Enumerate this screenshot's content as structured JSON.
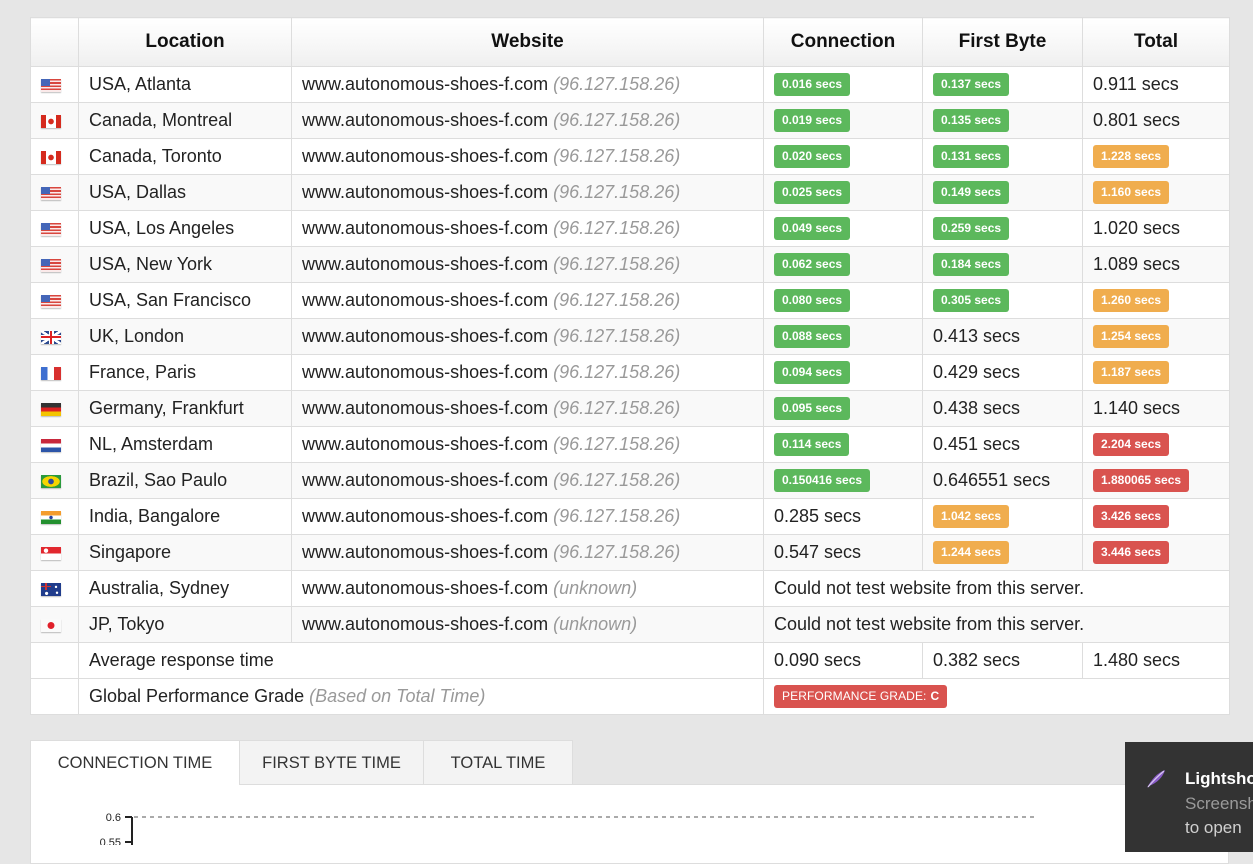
{
  "table": {
    "headers": {
      "flag": "",
      "location": "Location",
      "website": "Website",
      "connection": "Connection",
      "first_byte": "First Byte",
      "total": "Total"
    },
    "rows": [
      {
        "flag": "us",
        "location": "USA, Atlanta",
        "website": "www.autonomous-shoes-f.com",
        "ip": "(96.127.158.26)",
        "connection": {
          "value": "0.016 secs",
          "status": "good"
        },
        "first_byte": {
          "value": "0.137 secs",
          "status": "good"
        },
        "total": {
          "value": "0.911 secs",
          "status": "plain"
        }
      },
      {
        "flag": "ca",
        "location": "Canada, Montreal",
        "website": "www.autonomous-shoes-f.com",
        "ip": "(96.127.158.26)",
        "connection": {
          "value": "0.019 secs",
          "status": "good"
        },
        "first_byte": {
          "value": "0.135 secs",
          "status": "good"
        },
        "total": {
          "value": "0.801 secs",
          "status": "plain"
        }
      },
      {
        "flag": "ca",
        "location": "Canada, Toronto",
        "website": "www.autonomous-shoes-f.com",
        "ip": "(96.127.158.26)",
        "connection": {
          "value": "0.020 secs",
          "status": "good"
        },
        "first_byte": {
          "value": "0.131 secs",
          "status": "good"
        },
        "total": {
          "value": "1.228 secs",
          "status": "warn"
        }
      },
      {
        "flag": "us",
        "location": "USA, Dallas",
        "website": "www.autonomous-shoes-f.com",
        "ip": "(96.127.158.26)",
        "connection": {
          "value": "0.025 secs",
          "status": "good"
        },
        "first_byte": {
          "value": "0.149 secs",
          "status": "good"
        },
        "total": {
          "value": "1.160 secs",
          "status": "warn"
        }
      },
      {
        "flag": "us",
        "location": "USA, Los Angeles",
        "website": "www.autonomous-shoes-f.com",
        "ip": "(96.127.158.26)",
        "connection": {
          "value": "0.049 secs",
          "status": "good"
        },
        "first_byte": {
          "value": "0.259 secs",
          "status": "good"
        },
        "total": {
          "value": "1.020 secs",
          "status": "plain"
        }
      },
      {
        "flag": "us",
        "location": "USA, New York",
        "website": "www.autonomous-shoes-f.com",
        "ip": "(96.127.158.26)",
        "connection": {
          "value": "0.062 secs",
          "status": "good"
        },
        "first_byte": {
          "value": "0.184 secs",
          "status": "good"
        },
        "total": {
          "value": "1.089 secs",
          "status": "plain"
        }
      },
      {
        "flag": "us",
        "location": "USA, San Francisco",
        "website": "www.autonomous-shoes-f.com",
        "ip": "(96.127.158.26)",
        "connection": {
          "value": "0.080 secs",
          "status": "good"
        },
        "first_byte": {
          "value": "0.305 secs",
          "status": "good"
        },
        "total": {
          "value": "1.260 secs",
          "status": "warn"
        }
      },
      {
        "flag": "gb",
        "location": "UK, London",
        "website": "www.autonomous-shoes-f.com",
        "ip": "(96.127.158.26)",
        "connection": {
          "value": "0.088 secs",
          "status": "good"
        },
        "first_byte": {
          "value": "0.413 secs",
          "status": "plain"
        },
        "total": {
          "value": "1.254 secs",
          "status": "warn"
        }
      },
      {
        "flag": "fr",
        "location": "France, Paris",
        "website": "www.autonomous-shoes-f.com",
        "ip": "(96.127.158.26)",
        "connection": {
          "value": "0.094 secs",
          "status": "good"
        },
        "first_byte": {
          "value": "0.429 secs",
          "status": "plain"
        },
        "total": {
          "value": "1.187 secs",
          "status": "warn"
        }
      },
      {
        "flag": "de",
        "location": "Germany, Frankfurt",
        "website": "www.autonomous-shoes-f.com",
        "ip": "(96.127.158.26)",
        "connection": {
          "value": "0.095 secs",
          "status": "good"
        },
        "first_byte": {
          "value": "0.438 secs",
          "status": "plain"
        },
        "total": {
          "value": "1.140 secs",
          "status": "plain"
        }
      },
      {
        "flag": "nl",
        "location": "NL, Amsterdam",
        "website": "www.autonomous-shoes-f.com",
        "ip": "(96.127.158.26)",
        "connection": {
          "value": "0.114 secs",
          "status": "good"
        },
        "first_byte": {
          "value": "0.451 secs",
          "status": "plain"
        },
        "total": {
          "value": "2.204 secs",
          "status": "bad"
        }
      },
      {
        "flag": "br",
        "location": "Brazil, Sao Paulo",
        "website": "www.autonomous-shoes-f.com",
        "ip": "(96.127.158.26)",
        "connection": {
          "value": "0.150416 secs",
          "status": "good"
        },
        "first_byte": {
          "value": "0.646551 secs",
          "status": "plain"
        },
        "total": {
          "value": "1.880065 secs",
          "status": "bad"
        }
      },
      {
        "flag": "in",
        "location": "India, Bangalore",
        "website": "www.autonomous-shoes-f.com",
        "ip": "(96.127.158.26)",
        "connection": {
          "value": "0.285 secs",
          "status": "plain"
        },
        "first_byte": {
          "value": "1.042 secs",
          "status": "warn"
        },
        "total": {
          "value": "3.426 secs",
          "status": "bad"
        }
      },
      {
        "flag": "sg",
        "location": "Singapore",
        "website": "www.autonomous-shoes-f.com",
        "ip": "(96.127.158.26)",
        "connection": {
          "value": "0.547 secs",
          "status": "plain"
        },
        "first_byte": {
          "value": "1.244 secs",
          "status": "warn"
        },
        "total": {
          "value": "3.446 secs",
          "status": "bad"
        }
      },
      {
        "flag": "au",
        "location": "Australia, Sydney",
        "website": "www.autonomous-shoes-f.com",
        "ip": "(unknown)",
        "error": "Could not test website from this server."
      },
      {
        "flag": "jp",
        "location": "JP, Tokyo",
        "website": "www.autonomous-shoes-f.com",
        "ip": "(unknown)",
        "error": "Could not test website from this server."
      }
    ],
    "average": {
      "label": "Average response time",
      "connection": "0.090 secs",
      "first_byte": "0.382 secs",
      "total": "1.480 secs"
    },
    "grade": {
      "label": "Global Performance Grade",
      "note": "(Based on Total Time)",
      "badge_label": "PERFORMANCE GRADE:",
      "grade": "C",
      "status": "bad"
    }
  },
  "status_colors": {
    "good": "#5cb85c",
    "warn": "#f0ad4e",
    "bad": "#d9534f"
  },
  "chart_tabs": [
    {
      "label": "CONNECTION TIME",
      "active": true
    },
    {
      "label": "FIRST BYTE TIME",
      "active": false
    },
    {
      "label": "TOTAL TIME",
      "active": false
    }
  ],
  "chart": {
    "y_ticks": [
      "0.6",
      "0.55"
    ]
  },
  "toast": {
    "icon": "feather-icon",
    "title": "Lightsho",
    "line1": "Screensh",
    "line2": "to open"
  }
}
